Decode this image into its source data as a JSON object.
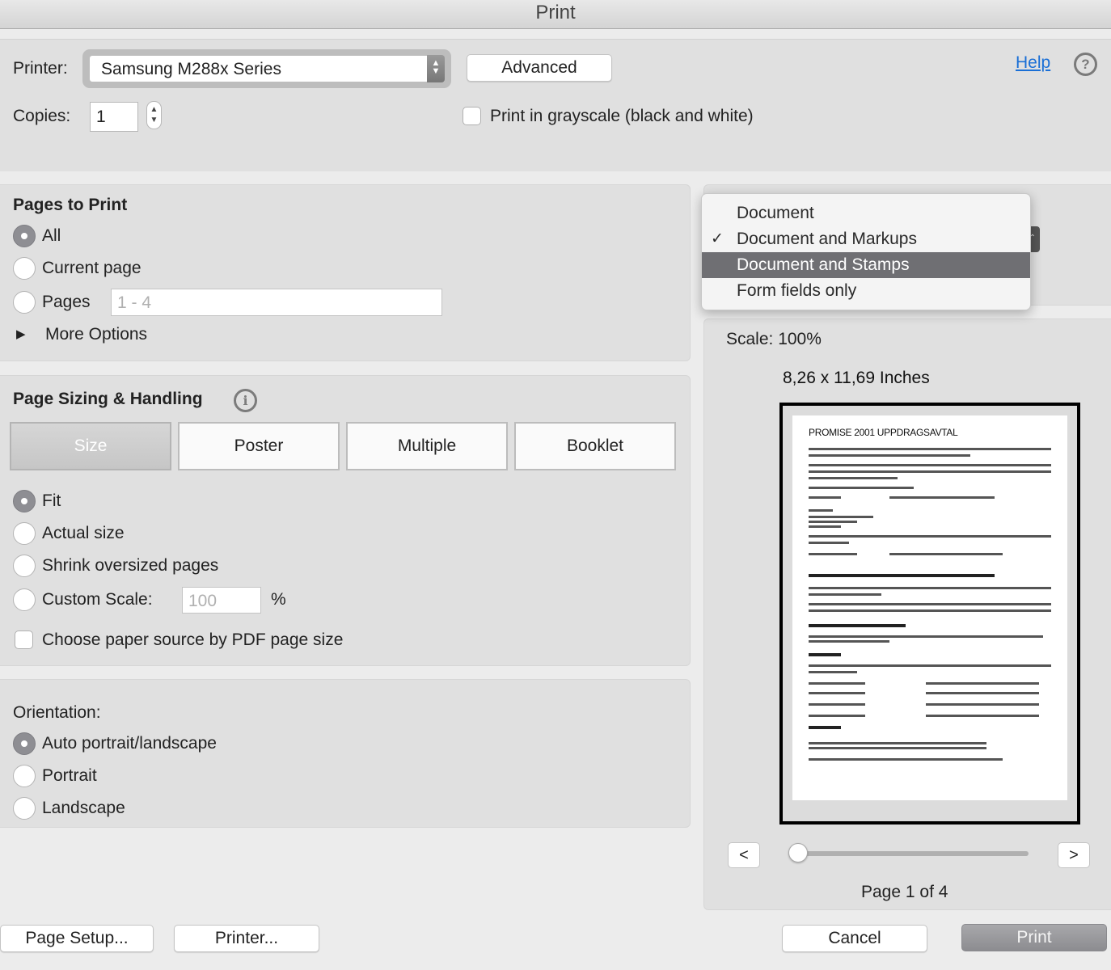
{
  "window": {
    "title": "Print"
  },
  "printer": {
    "label": "Printer:",
    "selected": "Samsung M288x Series",
    "advanced_label": "Advanced",
    "help_label": "Help",
    "copies_label": "Copies:",
    "copies_value": "1",
    "grayscale_label": "Print in grayscale (black and white)",
    "grayscale_checked": false
  },
  "pages_to_print": {
    "title": "Pages to Print",
    "options": [
      {
        "label": "All",
        "checked": true
      },
      {
        "label": "Current page",
        "checked": false
      },
      {
        "label": "Pages",
        "checked": false
      }
    ],
    "pages_placeholder": "1 - 4",
    "more_options_label": "More Options"
  },
  "page_sizing": {
    "title": "Page Sizing & Handling",
    "tabs": [
      {
        "label": "Size",
        "active": true
      },
      {
        "label": "Poster",
        "active": false
      },
      {
        "label": "Multiple",
        "active": false
      },
      {
        "label": "Booklet",
        "active": false
      }
    ],
    "options": [
      {
        "label": "Fit",
        "checked": true
      },
      {
        "label": "Actual size",
        "checked": false
      },
      {
        "label": "Shrink oversized pages",
        "checked": false
      },
      {
        "label": "Custom Scale:",
        "checked": false
      }
    ],
    "custom_scale_placeholder": "100",
    "percent_sign": "%",
    "paper_source_label": "Choose paper source by PDF page size",
    "paper_source_checked": false
  },
  "orientation": {
    "title": "Orientation:",
    "options": [
      {
        "label": "Auto portrait/landscape",
        "checked": true
      },
      {
        "label": "Portrait",
        "checked": false
      },
      {
        "label": "Landscape",
        "checked": false
      }
    ]
  },
  "comments_forms_menu": {
    "items": [
      {
        "label": "Document",
        "checked": false,
        "highlighted": false
      },
      {
        "label": "Document and Markups",
        "checked": true,
        "highlighted": false
      },
      {
        "label": "Document and Stamps",
        "checked": false,
        "highlighted": true
      },
      {
        "label": "Form fields only",
        "checked": false,
        "highlighted": false
      }
    ],
    "check_glyph": "✓"
  },
  "preview": {
    "scale_label": "Scale: 100%",
    "paper_size": "8,26 x 11,69 Inches",
    "document_title": "PROMISE 2001 UPPDRAGSAVTAL",
    "prev_label": "<",
    "next_label": ">",
    "current_page": 1,
    "total_pages": 4,
    "page_indicator": "Page 1 of 4"
  },
  "footer": {
    "page_setup_label": "Page Setup...",
    "printer_label": "Printer...",
    "cancel_label": "Cancel",
    "print_label": "Print"
  },
  "icons": {
    "select_stepper": "⌃⌄",
    "help": "?",
    "info": "i",
    "disclosure": "▶"
  },
  "colors": {
    "link": "#1a6fd6",
    "menu_highlight": "#6f6f73",
    "radio_checked": "#8e8e93"
  }
}
